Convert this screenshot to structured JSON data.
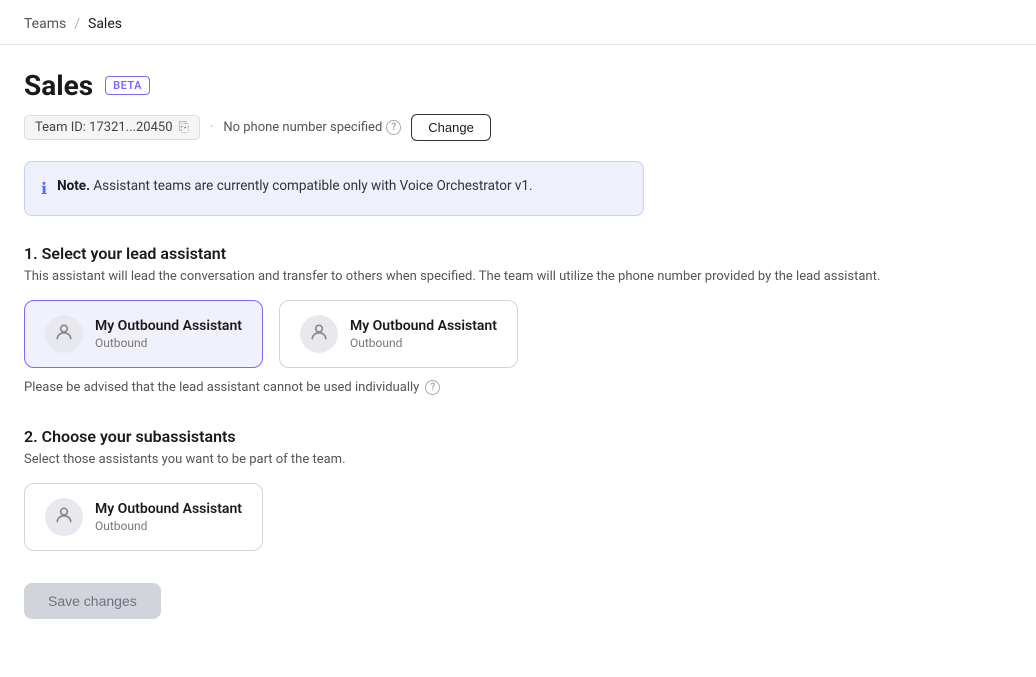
{
  "breadcrumb": {
    "teams_label": "Teams",
    "sales_label": "Sales"
  },
  "page": {
    "title": "Sales",
    "beta_badge": "BETA"
  },
  "meta": {
    "team_id_label": "Team ID: 17321...20450",
    "no_phone_text": "No phone number specified",
    "change_btn_label": "Change"
  },
  "note": {
    "prefix": "Note.",
    "text": " Assistant teams are currently compatible only with Voice Orchestrator v1."
  },
  "section1": {
    "title": "1. Select your lead assistant",
    "subtitle": "This assistant will lead the conversation and transfer to others when specified. The team will utilize the phone number provided by the lead assistant.",
    "cards": [
      {
        "name": "My Outbound Assistant",
        "type": "Outbound",
        "selected": true
      },
      {
        "name": "My Outbound Assistant",
        "type": "Outbound",
        "selected": false
      }
    ],
    "lead_note": "Please be advised that the lead assistant cannot be used individually"
  },
  "section2": {
    "title": "2. Choose your subassistants",
    "subtitle": "Select those assistants you want to be part of the team.",
    "cards": [
      {
        "name": "My Outbound Assistant",
        "type": "Outbound"
      }
    ]
  },
  "save_btn_label": "Save changes",
  "icons": {
    "person": "👤",
    "info": "ℹ",
    "copy": "⎘",
    "help": "?"
  }
}
